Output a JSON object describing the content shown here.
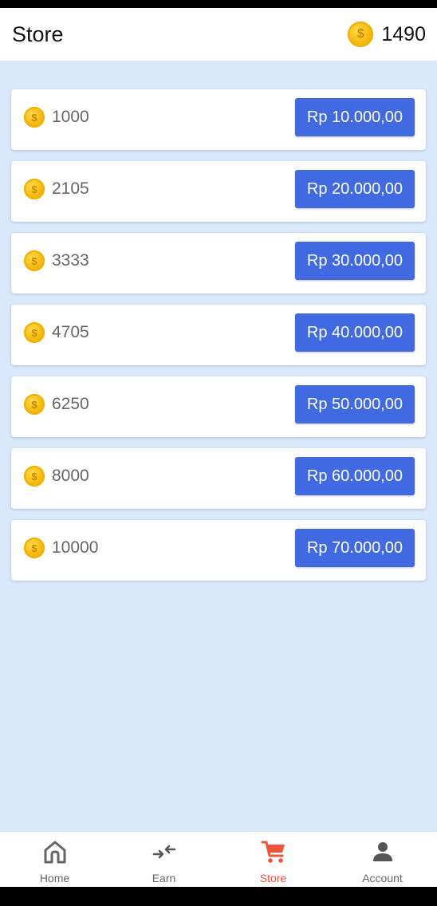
{
  "header": {
    "title": "Store",
    "balance": "1490",
    "coin_symbol": "$"
  },
  "store": {
    "items": [
      {
        "coins": "1000",
        "price": "Rp 10.000,00"
      },
      {
        "coins": "2105",
        "price": "Rp 20.000,00"
      },
      {
        "coins": "3333",
        "price": "Rp 30.000,00"
      },
      {
        "coins": "4705",
        "price": "Rp 40.000,00"
      },
      {
        "coins": "6250",
        "price": "Rp 50.000,00"
      },
      {
        "coins": "8000",
        "price": "Rp 60.000,00"
      },
      {
        "coins": "10000",
        "price": "Rp 70.000,00"
      }
    ]
  },
  "nav": {
    "items": [
      {
        "label": "Home",
        "icon": "home-icon"
      },
      {
        "label": "Earn",
        "icon": "swap-arrows-icon"
      },
      {
        "label": "Store",
        "icon": "cart-icon",
        "active": true
      },
      {
        "label": "Account",
        "icon": "person-icon"
      }
    ]
  },
  "colors": {
    "accent": "#4169e1",
    "background": "#d9e8fd",
    "active_nav": "#f0533a",
    "coin": "#f6b90f"
  }
}
